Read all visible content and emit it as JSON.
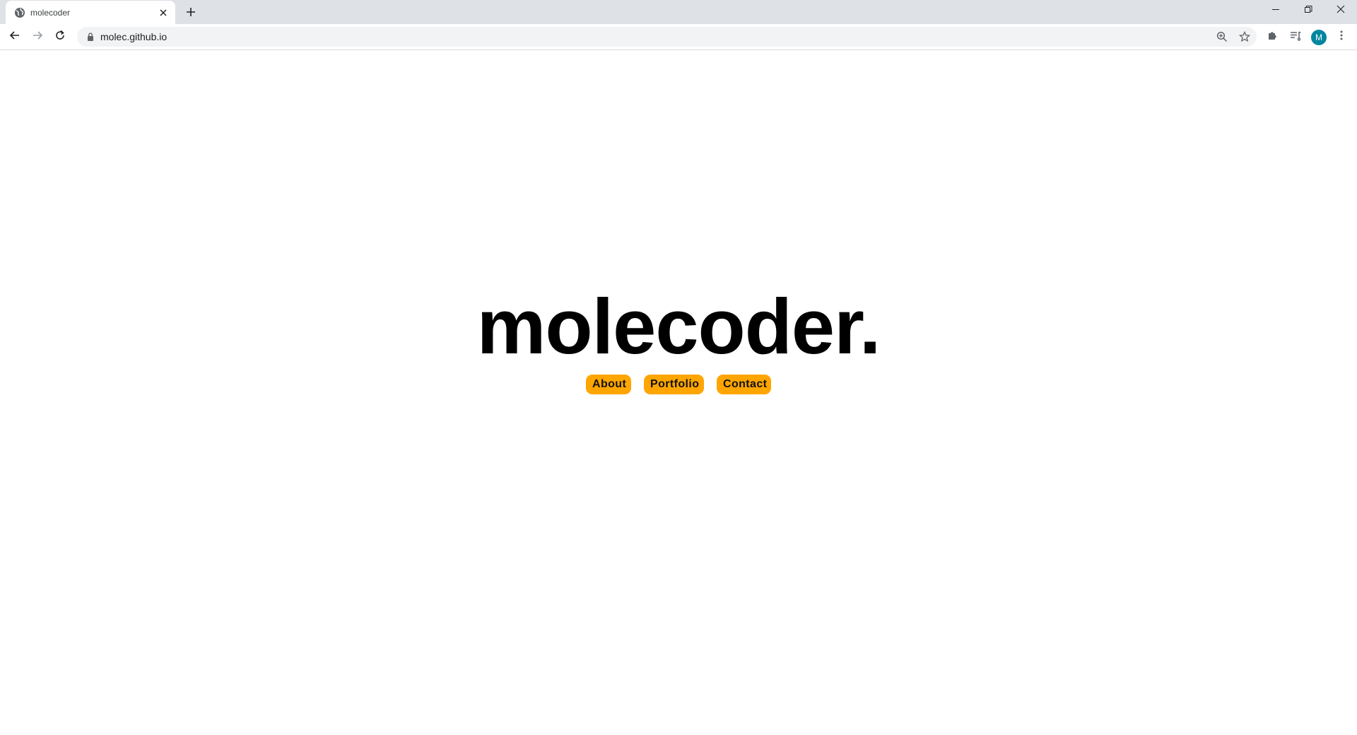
{
  "browser": {
    "tab": {
      "title": "molecoder",
      "favicon": "globe-icon"
    },
    "url": "molec.github.io",
    "profile_initial": "M",
    "icons": {
      "close_tab": "close-icon",
      "new_tab": "plus-icon",
      "minimize": "minimize-icon",
      "maximize": "restore-icon",
      "close_window": "close-icon",
      "back": "arrow-left-icon",
      "forward": "arrow-right-icon",
      "reload": "reload-icon",
      "lock": "lock-icon",
      "zoom": "zoom-in-icon",
      "bookmark": "star-icon",
      "extensions": "puzzle-icon",
      "reading_list": "reading-list-icon",
      "menu": "kebab-menu-icon"
    },
    "colors": {
      "avatar_bg": "#00869e",
      "tabstrip_bg": "#dee1e6",
      "omnibox_bg": "#f1f3f4"
    }
  },
  "page": {
    "title": "molecoder.",
    "nav": [
      {
        "label": "About"
      },
      {
        "label": "Portfolio"
      },
      {
        "label": "Contact"
      }
    ],
    "colors": {
      "button_bg": "#ffa500",
      "title_color": "#000000"
    }
  }
}
